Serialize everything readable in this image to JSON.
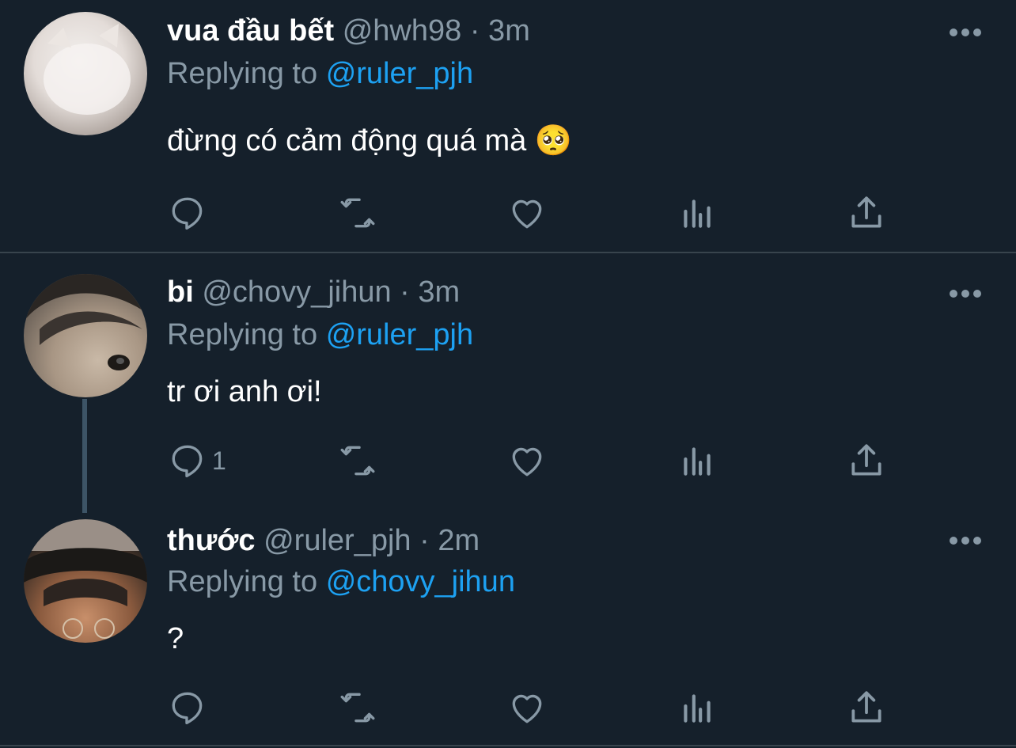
{
  "tweets": [
    {
      "name": "vua đầu bết",
      "handle": "@hwh98",
      "time": "· 3m",
      "replying_prefix": "Replying to",
      "replying_to": "@ruler_pjh",
      "text": "đừng có cảm động quá mà 🥺",
      "reply_count": "",
      "avatar_icon": "avatar-cat-photo"
    },
    {
      "name": "bi",
      "handle": "@chovy_jihun",
      "time": "· 3m",
      "replying_prefix": "Replying to",
      "replying_to": "@ruler_pjh",
      "text": "tr ơi anh ơi!",
      "reply_count": "1",
      "avatar_icon": "avatar-face-photo"
    },
    {
      "name": "thước",
      "handle": "@ruler_pjh",
      "time": "· 2m",
      "replying_prefix": "Replying to",
      "replying_to": "@chovy_jihun",
      "text": "?",
      "reply_count": "",
      "avatar_icon": "avatar-hat-photo"
    }
  ],
  "colors": {
    "background": "#15202b",
    "text": "#ffffff",
    "secondary": "#8899a6",
    "accent": "#1da1f2",
    "divider": "#38444d"
  },
  "icons": [
    "reply-icon",
    "retweet-icon",
    "like-icon",
    "analytics-icon",
    "share-icon",
    "more-icon"
  ]
}
